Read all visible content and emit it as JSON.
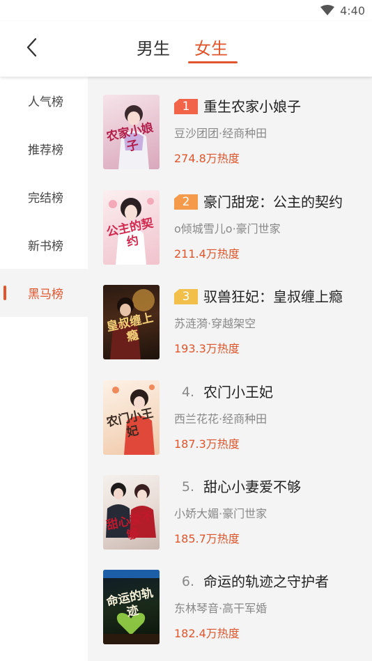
{
  "status_bar": {
    "time": "4:40",
    "wifi_icon": "wifi-icon"
  },
  "header": {
    "back_icon": "chevron-left-icon",
    "tabs": [
      {
        "label": "男生",
        "active": false
      },
      {
        "label": "女生",
        "active": true
      }
    ]
  },
  "sidebar": {
    "items": [
      {
        "label": "人气榜",
        "active": false
      },
      {
        "label": "推荐榜",
        "active": false
      },
      {
        "label": "完结榜",
        "active": false
      },
      {
        "label": "新书榜",
        "active": false
      },
      {
        "label": "黑马榜",
        "active": true
      }
    ]
  },
  "colors": {
    "accent": "#e0552b",
    "rank1": "#f2644a",
    "rank2": "#f59a4a",
    "rank3": "#f2c04a"
  },
  "books": [
    {
      "rank": "1",
      "title": "重生农家小娘子",
      "meta": "豆沙团团·经商种田",
      "heat": "274.8万热度",
      "cover_text": "农家小娘子"
    },
    {
      "rank": "2",
      "title": "豪门甜宠：公主的契约",
      "meta": "o倾城雪儿o·豪门世家",
      "heat": "211.4万热度",
      "cover_text": "公主的契约"
    },
    {
      "rank": "3",
      "title": "驭兽狂妃：皇叔缠上瘾",
      "meta": "苏涟漪·穿越架空",
      "heat": "193.3万热度",
      "cover_text": "皇叔缠上瘾"
    },
    {
      "rank": "4.",
      "title": "农门小王妃",
      "meta": "西兰花花·经商种田",
      "heat": "187.3万热度",
      "cover_text": "农门小王妃"
    },
    {
      "rank": "5.",
      "title": "甜心小妻爱不够",
      "meta": "小娇大媚·豪门世家",
      "heat": "185.7万热度",
      "cover_text": "甜心爱不够"
    },
    {
      "rank": "6.",
      "title": "命运的轨迹之守护者",
      "meta": "东林琴音·高干军婚",
      "heat": "182.4万热度",
      "cover_text": "命运的轨迹"
    }
  ]
}
